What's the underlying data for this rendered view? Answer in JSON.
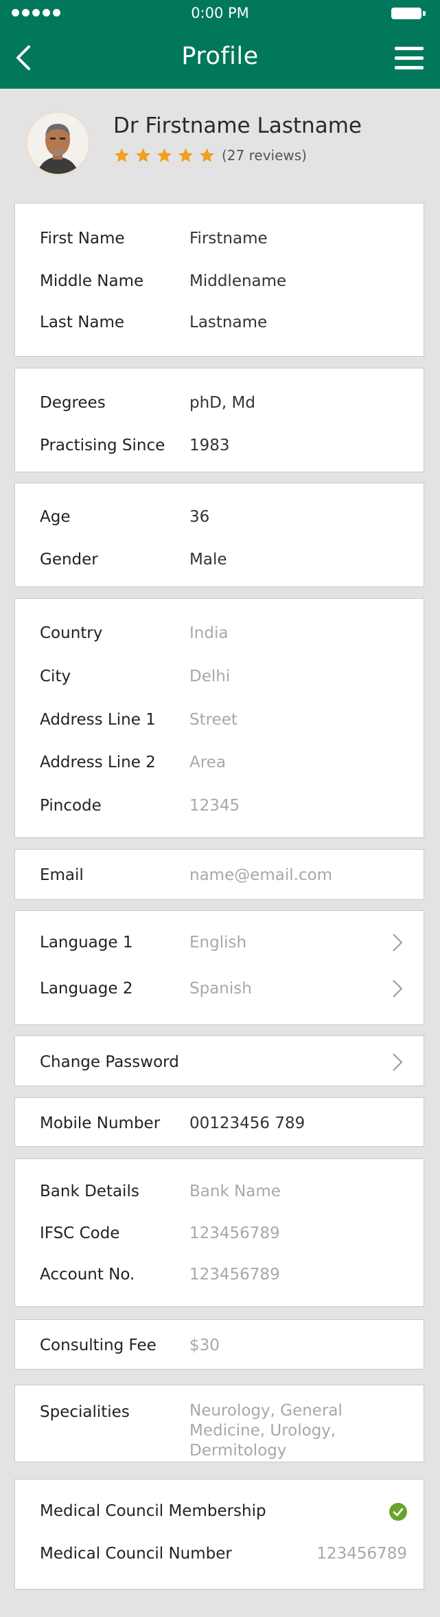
{
  "status_bar": {
    "time": "0:00 PM"
  },
  "navbar": {
    "title": "Profile"
  },
  "profile": {
    "name": "Dr Firstname Lastname",
    "rating": 5,
    "max_rating": 5,
    "reviews": "(27 reviews)"
  },
  "name_card": {
    "first_name": {
      "label": "First Name",
      "value": "Firstname"
    },
    "middle_name": {
      "label": "Middle Name",
      "value": "Middlename"
    },
    "last_name": {
      "label": "Last Name",
      "value": "Lastname"
    }
  },
  "education_card": {
    "degrees": {
      "label": "Degrees",
      "value": "phD, Md"
    },
    "practising_since": {
      "label": "Practising Since",
      "value": "1983"
    }
  },
  "personal_card": {
    "age": {
      "label": "Age",
      "value": "36"
    },
    "gender": {
      "label": "Gender",
      "value": "Male"
    }
  },
  "address_card": {
    "country": {
      "label": "Country",
      "value": "India"
    },
    "city": {
      "label": "City",
      "value": "Delhi"
    },
    "address_line_1": {
      "label": "Address Line 1",
      "value": "Street"
    },
    "address_line_2": {
      "label": "Address Line 2",
      "value": "Area"
    },
    "pincode": {
      "label": "Pincode",
      "value": "12345"
    }
  },
  "email_card": {
    "email": {
      "label": "Email",
      "value": "name@email.com"
    }
  },
  "language_card": {
    "language_1": {
      "label": "Language 1",
      "value": "English"
    },
    "language_2": {
      "label": "Language 2",
      "value": "Spanish"
    }
  },
  "password_card": {
    "label": "Change Password"
  },
  "mobile_card": {
    "label": "Mobile Number",
    "value": "00123456 789"
  },
  "bank_card": {
    "bank_details": {
      "label": "Bank Details",
      "value": "Bank Name"
    },
    "ifsc_code": {
      "label": "IFSC Code",
      "value": "123456789"
    },
    "account_no": {
      "label": "Account No.",
      "value": "123456789"
    }
  },
  "fee_card": {
    "label": "Consulting Fee",
    "value": "$30"
  },
  "specialities_card": {
    "label": "Specialities",
    "value": "Neurology, General Medicine, Urology, Dermitology"
  },
  "council_card": {
    "membership": {
      "label": "Medical Council Membership",
      "verified": true
    },
    "number": {
      "label": "Medical Council Number",
      "value": "123456789"
    }
  },
  "colors": {
    "primary": "#007859",
    "star": "#f0a01e",
    "check": "#6aa32c",
    "background": "#e3e3e3"
  },
  "icons": [
    "back-arrow-icon",
    "hamburger-menu-icon",
    "star-icon",
    "chevron-right-icon",
    "check-circle-icon"
  ]
}
